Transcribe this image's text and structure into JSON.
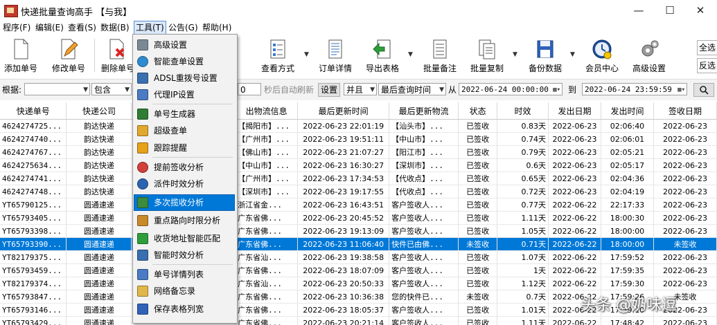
{
  "window": {
    "title": "快递批量查询高手 【与我】",
    "minimize": "—",
    "maximize": "☐",
    "close": "✕"
  },
  "menu": [
    "程序(F)",
    "编辑(E)",
    "查看(S)",
    "数据(B)",
    "工具(T)",
    "公告(G)",
    "帮助(H)"
  ],
  "toolbar": {
    "add": "添加单号",
    "edit": "修改单号",
    "delete": "删除单号",
    "view_mode": "查看方式",
    "order_detail": "订单详情",
    "export": "导出表格",
    "batch_note": "批量备注",
    "batch_copy": "批量复制",
    "backup": "备份数据",
    "member": "会员中心",
    "advanced": "高级设置",
    "select_all": "全选",
    "invert": "反选"
  },
  "filter": {
    "by_label": "根据:",
    "by_value": "",
    "match": "包含",
    "interval": "0",
    "auto_refresh": "秒后自动刷新",
    "set": "设置",
    "logic": "并且",
    "time_field": "最后查询时间",
    "from_label": "从",
    "from": "2022-06-24 00:00:00",
    "to_label": "到",
    "to": "2022-06-24 23:59:59",
    "search_icon": "magnifier-icon"
  },
  "columns": [
    "快递单号",
    "快递公司",
    "",
    "出物流信息",
    "最后更新时间",
    "最后更新物流",
    "状态",
    "时效",
    "发出日期",
    "发出时间",
    "签收日期"
  ],
  "rows": [
    [
      "4624274725...",
      "韵达快递",
      "【揭阳市】...",
      "2022-06-23 22:01:19",
      "【汕头市】...",
      "已签收",
      "0.83天",
      "2022-06-23",
      "02:06:40",
      "2022-06-23"
    ],
    [
      "4624274740...",
      "韵达快递",
      "【广州市】...",
      "2022-06-23 19:51:11",
      "【中山市】...",
      "已签收",
      "0.74天",
      "2022-06-23",
      "02:06:01",
      "2022-06-23"
    ],
    [
      "4624274767...",
      "韵达快递",
      "【佛山市】...",
      "2022-06-23 21:07:27",
      "【阳江市】...",
      "已签收",
      "0.79天",
      "2022-06-23",
      "02:05:21",
      "2022-06-23"
    ],
    [
      "4624275634...",
      "韵达快递",
      "【中山市】...",
      "2022-06-23 16:30:27",
      "【深圳市】...",
      "已签收",
      "0.6天",
      "2022-06-23",
      "02:05:17",
      "2022-06-23"
    ],
    [
      "4624274741...",
      "韵达快递",
      "【广州市】...",
      "2022-06-23 17:34:53",
      "【代收点】...",
      "已签收",
      "0.65天",
      "2022-06-23",
      "02:04:36",
      "2022-06-23"
    ],
    [
      "4624274748...",
      "韵达快递",
      "【深圳市】...",
      "2022-06-23 19:17:55",
      "【代收点】...",
      "已签收",
      "0.72天",
      "2022-06-23",
      "02:04:19",
      "2022-06-23"
    ],
    [
      "YT65790125...",
      "圆通速递",
      "浙江省金...",
      "2022-06-23 16:43:51",
      "客户签收人...",
      "已签收",
      "0.77天",
      "2022-06-22",
      "22:17:33",
      "2022-06-23"
    ],
    [
      "YT65793405...",
      "圆通速递",
      "广东省佛...",
      "2022-06-23 20:45:52",
      "客户签收人...",
      "已签收",
      "1.11天",
      "2022-06-22",
      "18:00:30",
      "2022-06-23"
    ],
    [
      "YT65793398...",
      "圆通速递",
      "广东省佛...",
      "2022-06-23 19:13:09",
      "客户签收人...",
      "已签收",
      "1.05天",
      "2022-06-22",
      "18:00:00",
      "2022-06-23"
    ],
    [
      "YT65793390...",
      "圆通速递",
      "广东省佛...",
      "2022-06-23 11:06:40",
      "快件已由佛...",
      "未签收",
      "0.71天",
      "2022-06-22",
      "18:00:00",
      "未签收"
    ],
    [
      "YT82179375...",
      "圆通速递",
      "广东省汕...",
      "2022-06-23 19:38:58",
      "客户签收人...",
      "已签收",
      "1.07天",
      "2022-06-22",
      "17:59:52",
      "2022-06-23"
    ],
    [
      "YT65793459...",
      "圆通速递",
      "广东省佛...",
      "2022-06-23 18:07:09",
      "客户签收人...",
      "已签收",
      "1天",
      "2022-06-22",
      "17:59:35",
      "2022-06-23"
    ],
    [
      "YT82179374...",
      "圆通速递",
      "广东省汕...",
      "2022-06-23 20:50:33",
      "客户签收人...",
      "已签收",
      "1.12天",
      "2022-06-22",
      "17:59:30",
      "2022-06-23"
    ],
    [
      "YT65793847...",
      "圆通速递",
      "广东省佛...",
      "2022-06-23 10:36:38",
      "您的快件已...",
      "未签收",
      "0.7天",
      "2022-06-22",
      "17:59:26",
      "未签收"
    ],
    [
      "YT65793146...",
      "圆通速递",
      "广东省佛...",
      "2022-06-23 18:05:37",
      "客户签收人...",
      "已签收",
      "1.01天",
      "2022-06-22",
      "17:59:10",
      "2022-06-23"
    ],
    [
      "YT65793429...",
      "圆通速递",
      "广东省佛...",
      "2022-06-23 20:21:14",
      "客户签收人...",
      "已签收",
      "1.11天",
      "2022-06-22",
      "17:48:42",
      "2022-06-23"
    ]
  ],
  "selected_row": 9,
  "dropdown": [
    {
      "label": "高级设置",
      "icon": "gear-icon"
    },
    {
      "label": "智能查单设置",
      "icon": "globe-icon"
    },
    {
      "label": "ADSL重拨号设置",
      "icon": "network-icon"
    },
    {
      "label": "代理IP设置",
      "icon": "proxy-icon"
    },
    {
      "label": "单号生成器",
      "icon": "truck-icon"
    },
    {
      "label": "超级查单",
      "icon": "folder-icon"
    },
    {
      "label": "跟踪提醒",
      "icon": "bell-icon"
    },
    {
      "label": "提前签收分析",
      "icon": "pie-chart-icon"
    },
    {
      "label": "派件时效分析",
      "icon": "clock-icon"
    },
    {
      "label": "多次揽收分析",
      "icon": "trend-icon"
    },
    {
      "label": "重点路向时限分析",
      "icon": "chart-icon"
    },
    {
      "label": "收货地址智能匹配",
      "icon": "check-icon"
    },
    {
      "label": "智能时效分析",
      "icon": "bar-chart-icon"
    },
    {
      "label": "单号详情列表",
      "icon": "list-icon"
    },
    {
      "label": "网络备忘录",
      "icon": "memo-icon"
    },
    {
      "label": "保存表格列宽",
      "icon": "save-icon"
    }
  ],
  "dropdown_highlight": 9,
  "watermark": "头条 @奶味逗"
}
